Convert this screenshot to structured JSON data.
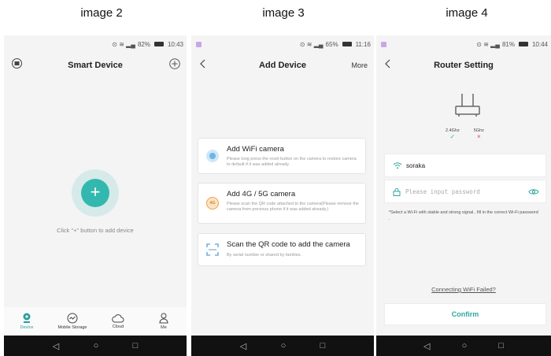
{
  "captions": [
    "image 2",
    "image 3",
    "image 4"
  ],
  "colors": {
    "accent": "#33b8b0",
    "confirm_text": "#2fa79f",
    "ok": "#3cbd6c",
    "error": "#e0445a"
  },
  "phone1": {
    "status": {
      "battery": "82%",
      "time": "10:43"
    },
    "title": "Smart Device",
    "left_icon": "menu-icon",
    "right_icon": "add-circle-icon",
    "hint": "Click \"+\" button to add device",
    "tabs": [
      {
        "label": "Device",
        "icon": "camera-icon",
        "active": true
      },
      {
        "label": "Mobile Storage",
        "icon": "storage-icon",
        "active": false
      },
      {
        "label": "Cloud",
        "icon": "cloud-icon",
        "active": false
      },
      {
        "label": "Me",
        "icon": "person-icon",
        "active": false
      }
    ]
  },
  "phone2": {
    "status": {
      "battery": "65%",
      "time": "11:16"
    },
    "title": "Add Device",
    "more": "More",
    "cards": [
      {
        "title": "Add WiFi camera",
        "desc": "Please long press the reset button on the camera to restore camera to default if it was added already.",
        "icon": "wifi-camera-icon"
      },
      {
        "title": "Add 4G / 5G camera",
        "desc": "Please scan the QR code attached to the camera(Please remove the camera from previous phone if it was added already.)",
        "icon": "4g-icon",
        "badge": "4G"
      },
      {
        "title": "Scan the QR code to add the camera",
        "desc": "By serial number or shared by families.",
        "icon": "qr-scan-icon"
      }
    ]
  },
  "phone3": {
    "status": {
      "battery": "81%",
      "time": "10:44"
    },
    "title": "Router Setting",
    "bands": [
      {
        "label": "2.4Ghz",
        "mark": "✓"
      },
      {
        "label": "5Ghz",
        "mark": "×"
      }
    ],
    "ssid": "soraka",
    "password_placeholder": "Please input password",
    "note": "*Select a Wi-Fi with stable and strong signal , fill in the correct Wi-Fi password .",
    "failed_link": "Connecting WiFi Failed?",
    "confirm": "Confirm"
  },
  "sysnav": {
    "back": "◁",
    "home": "○",
    "recent": "□"
  }
}
